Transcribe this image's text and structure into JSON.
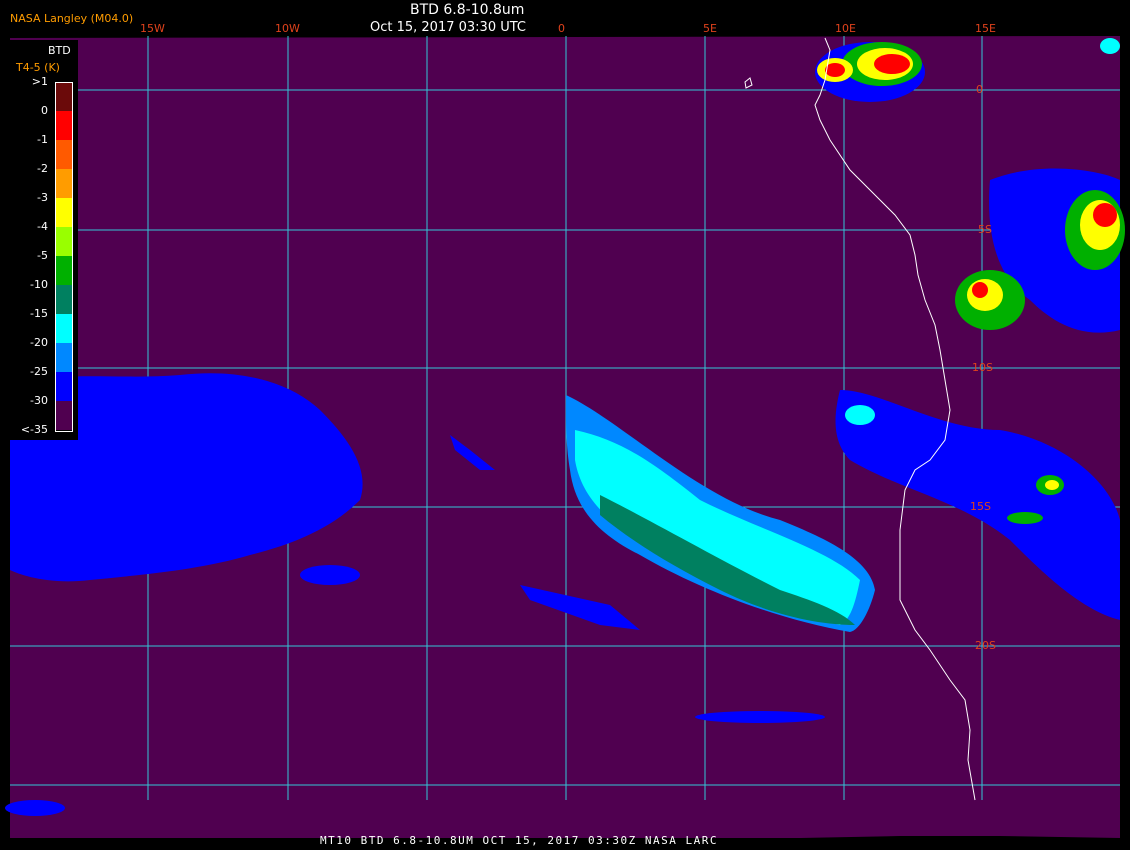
{
  "header": {
    "credit": "NASA Langley (M04.0)",
    "title": "BTD 6.8-10.8um",
    "subtitle": "Oct 15, 2017 03:30 UTC"
  },
  "footer": {
    "text": "MT10  BTD 6.8-10.8UM  OCT 15, 2017 03:30Z  NASA LARC"
  },
  "longitude_labels": [
    "15W",
    "10W",
    "0",
    "5E",
    "10E",
    "15E"
  ],
  "latitude_labels": [
    "0",
    "5S",
    "10S",
    "15S",
    "20S"
  ],
  "legend": {
    "title": "BTD",
    "unit": "T4-5 (K)",
    "ticks": [
      ">1",
      "0",
      "-1",
      "-2",
      "-3",
      "-4",
      "-5",
      "-10",
      "-15",
      "-20",
      "-25",
      "-30",
      "<-35"
    ],
    "colors": [
      "#6b0a0a",
      "#ff0000",
      "#ff5a00",
      "#ff9c00",
      "#ffff00",
      "#99ff00",
      "#00b000",
      "#008060",
      "#00ffff",
      "#0088ff",
      "#0000ff",
      "#500050"
    ]
  },
  "colors": {
    "background": "#500050",
    "grid": "#33c6d6",
    "coastline": "#ffffff",
    "label": "#e0421c",
    "credit": "#ff9c00"
  }
}
